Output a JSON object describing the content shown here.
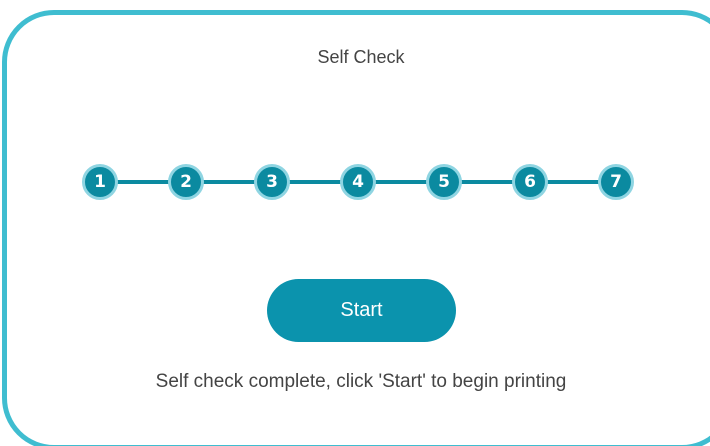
{
  "dialog": {
    "title": "Self Check",
    "steps": [
      "1",
      "2",
      "3",
      "4",
      "5",
      "6",
      "7"
    ],
    "start_label": "Start",
    "hint": "Self check complete, click 'Start' to begin printing"
  },
  "colors": {
    "accent_border": "#3fbdd0",
    "step_fill": "#0b8aa0",
    "step_ring": "#8fd5e2",
    "button": "#0b93ad",
    "text": "#444444"
  }
}
